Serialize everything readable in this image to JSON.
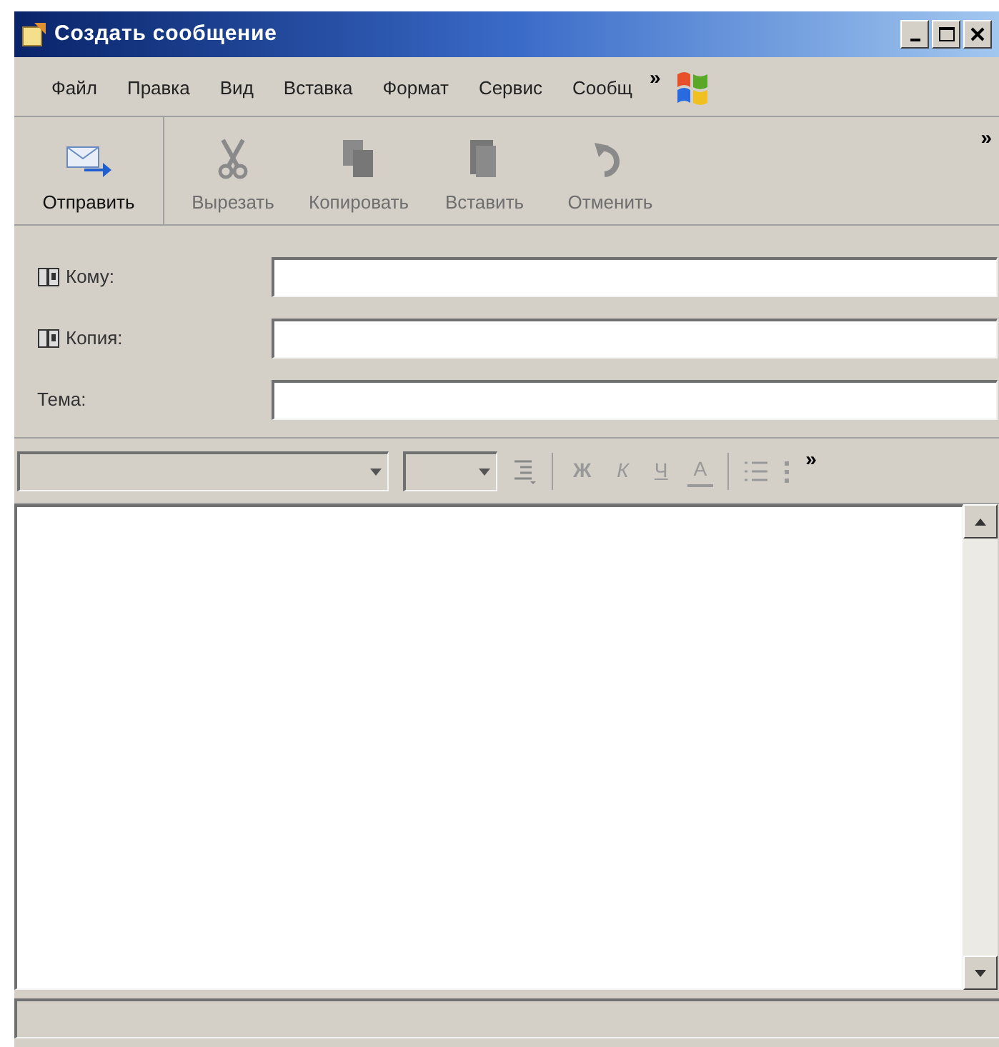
{
  "window": {
    "title": "Создать сообщение"
  },
  "menu": {
    "items": [
      "Файл",
      "Правка",
      "Вид",
      "Вставка",
      "Формат",
      "Сервис",
      "Сообщ"
    ],
    "overflow": "»"
  },
  "toolbar": {
    "buttons": [
      {
        "label": "Отправить",
        "kind": "send",
        "disabled": false
      },
      {
        "label": "Вырезать",
        "kind": "cut",
        "disabled": true
      },
      {
        "label": "Копировать",
        "kind": "copy",
        "disabled": true
      },
      {
        "label": "Вставить",
        "kind": "paste",
        "disabled": true
      },
      {
        "label": "Отменить",
        "kind": "undo",
        "disabled": true
      }
    ],
    "overflow": "»"
  },
  "fields": [
    {
      "label": "Кому:",
      "address_book": true
    },
    {
      "label": "Копия:",
      "address_book": true
    },
    {
      "label": "Тема:",
      "address_book": false
    }
  ],
  "format_toolbar": {
    "bold": "Ж",
    "italic": "К",
    "underline": "Ч",
    "font_color": "А",
    "overflow": "»"
  }
}
